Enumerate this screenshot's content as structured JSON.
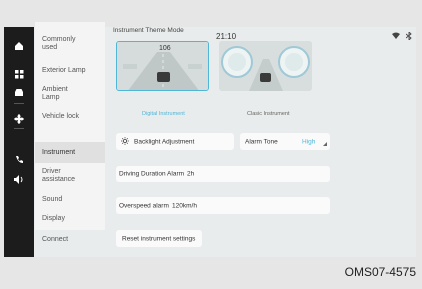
{
  "status": {
    "time": "21:10",
    "wifi_icon": "wifi-icon",
    "bluetooth_icon": "bluetooth-icon"
  },
  "rail": {
    "icons": [
      "home-icon",
      "apps-icon",
      "car-icon",
      "fan-icon",
      "phone-icon",
      "volume-icon"
    ]
  },
  "menu": {
    "items": [
      {
        "label": "Commonly used"
      },
      {
        "label": "Exterior Lamp"
      },
      {
        "label": "Ambient Lamp"
      },
      {
        "label": "Vehicle lock"
      },
      {
        "label": "Instrument"
      },
      {
        "label": "Driver assistance"
      },
      {
        "label": "Sound"
      },
      {
        "label": "Display"
      },
      {
        "label": "Connect"
      }
    ],
    "active_index": 4
  },
  "main": {
    "section_title": "Instrument Theme Mode",
    "themes": [
      {
        "caption": "Digital Instrument",
        "speed": "106",
        "selected": true
      },
      {
        "caption": "Clasic Instrument",
        "selected": false
      }
    ],
    "backlight_label": "Backlight Adjustment",
    "alarm_tone_label": "Alarm Tone",
    "alarm_tone_value": "High",
    "driving_alarm_label": "Driving Duration Alarm",
    "driving_alarm_value": "2h",
    "overspeed_label": "Overspeed alarm",
    "overspeed_value": "120km/h",
    "reset_label": "Reset instrument settings"
  },
  "footer_code": "OMS07-4575",
  "colors": {
    "accent": "#4fb6d8",
    "rail_bg": "#1c1c1c",
    "menu_active": "#e0e0e0"
  }
}
